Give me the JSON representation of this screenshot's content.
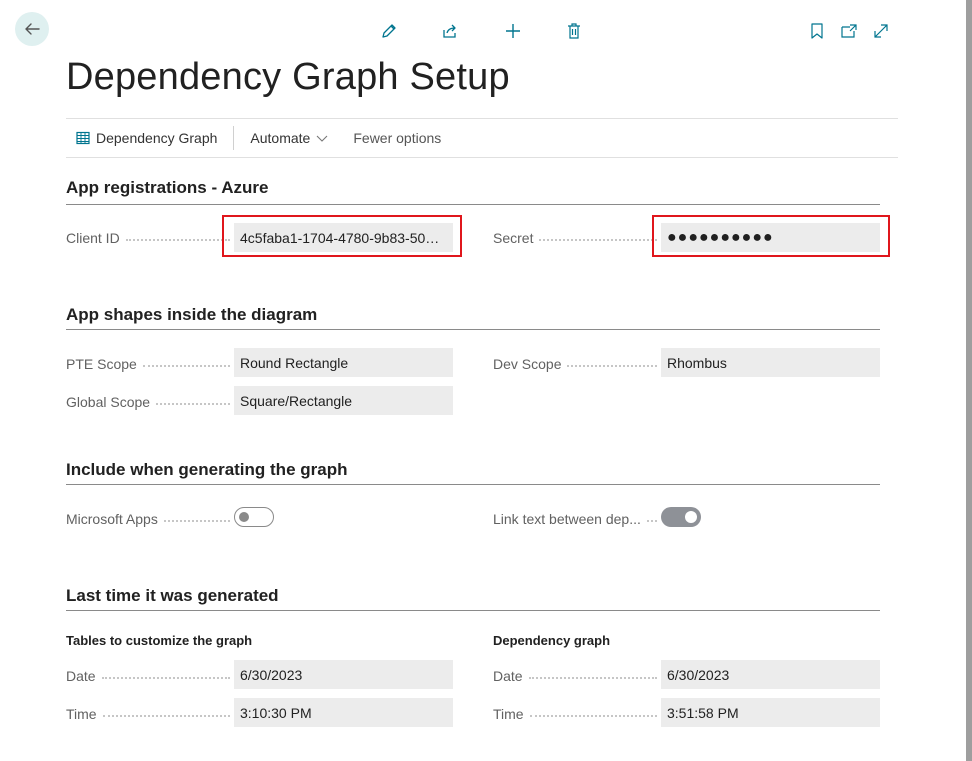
{
  "page": {
    "title": "Dependency Graph Setup"
  },
  "toolbar": {
    "back_icon": "arrow-left-icon",
    "edit_icon": "pencil-icon",
    "share_icon": "share-icon",
    "new_icon": "plus-icon",
    "delete_icon": "trash-icon",
    "bookmark_icon": "bookmark-icon",
    "open_new_window_icon": "open-in-new-window-icon",
    "expand_icon": "expand-icon"
  },
  "actionbar": {
    "dependency_graph": "Dependency Graph",
    "automate": "Automate",
    "fewer_options": "Fewer options"
  },
  "sections": {
    "app_registrations": {
      "title": "App registrations - Azure",
      "client_id_label": "Client ID",
      "client_id_value": "4c5faba1-1704-4780-9b83-505…",
      "secret_label": "Secret",
      "secret_value": "●●●●●●●●●●"
    },
    "app_shapes": {
      "title": "App shapes inside the diagram",
      "pte_scope_label": "PTE Scope",
      "pte_scope_value": "Round Rectangle",
      "dev_scope_label": "Dev Scope",
      "dev_scope_value": "Rhombus",
      "global_scope_label": "Global Scope",
      "global_scope_value": "Square/Rectangle"
    },
    "include": {
      "title": "Include when generating the graph",
      "microsoft_apps_label": "Microsoft Apps",
      "microsoft_apps_on": false,
      "link_text_label": "Link text between dep...",
      "link_text_on": true
    },
    "last_generated": {
      "title": "Last time it was generated",
      "tables_heading": "Tables to customize the graph",
      "tables_date_label": "Date",
      "tables_date_value": "6/30/2023",
      "tables_time_label": "Time",
      "tables_time_value": "3:10:30 PM",
      "graph_heading": "Dependency graph",
      "graph_date_label": "Date",
      "graph_date_value": "6/30/2023",
      "graph_time_label": "Time",
      "graph_time_value": "3:51:58 PM"
    }
  },
  "colors": {
    "accent": "#00758f",
    "highlight": "#e0161c",
    "field_bg": "#ececec"
  }
}
